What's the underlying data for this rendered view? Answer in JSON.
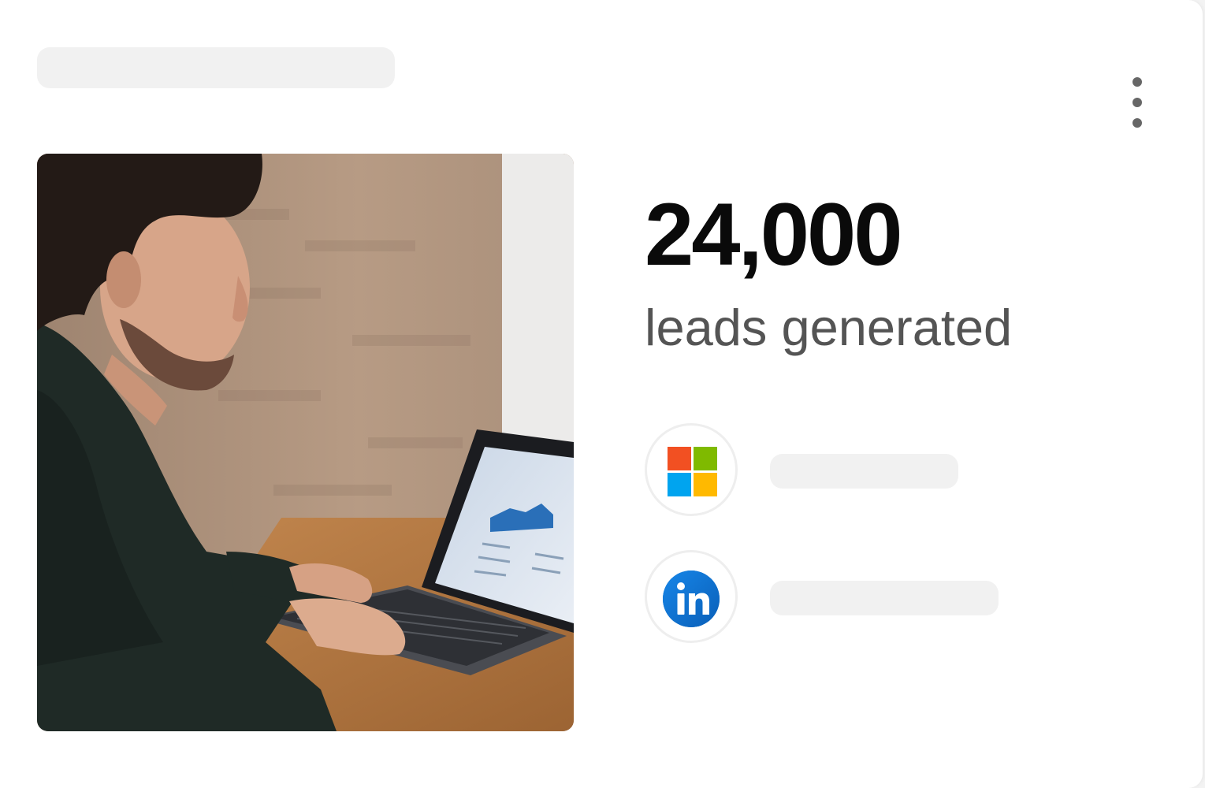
{
  "card": {
    "metric": {
      "value": "24,000",
      "label": "leads generated"
    },
    "sources": [
      {
        "icon": "microsoft-logo-icon",
        "colors": [
          "#f25022",
          "#7fba00",
          "#00a4ef",
          "#ffb900"
        ]
      },
      {
        "icon": "linkedin-logo-icon",
        "color": "#0a66c2"
      }
    ],
    "photo": {
      "subject": "man-working-on-laptop"
    }
  }
}
